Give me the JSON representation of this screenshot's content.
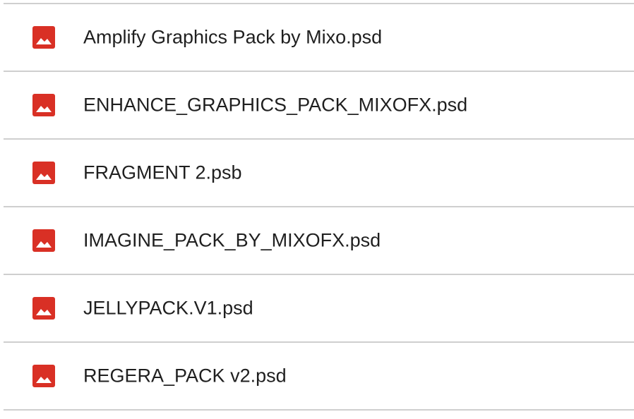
{
  "files": [
    {
      "name": "Amplify Graphics Pack by Mixo.psd",
      "icon": "image-file-icon"
    },
    {
      "name": "ENHANCE_GRAPHICS_PACK_MIXOFX.psd",
      "icon": "image-file-icon"
    },
    {
      "name": "FRAGMENT 2.psb",
      "icon": "image-file-icon"
    },
    {
      "name": "IMAGINE_PACK_BY_MIXOFX.psd",
      "icon": "image-file-icon"
    },
    {
      "name": "JELLYPACK.V1.psd",
      "icon": "image-file-icon"
    },
    {
      "name": "REGERA_PACK v2.psd",
      "icon": "image-file-icon"
    }
  ],
  "colors": {
    "icon": "#d93025",
    "text": "#1f1f1f",
    "divider": "#cfcfcf"
  }
}
